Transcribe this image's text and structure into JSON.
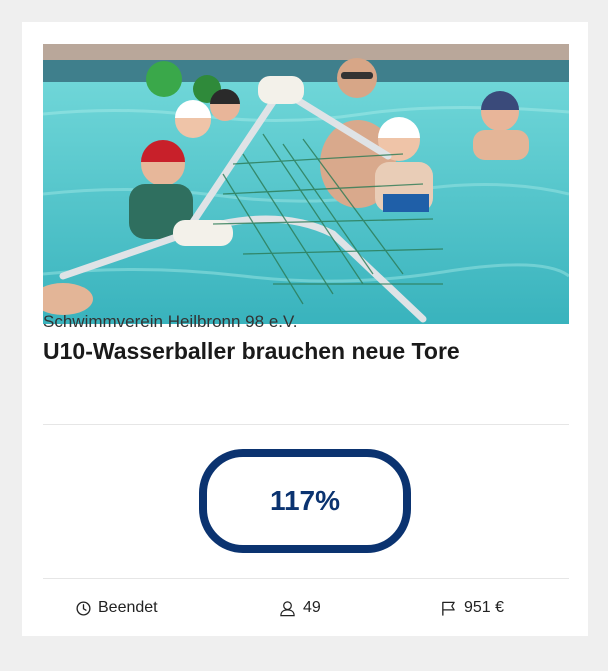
{
  "project": {
    "organization": "Schwimmverein Heilbronn 98 e.V.",
    "title": "U10-Wasserballer brauchen neue Tore",
    "progress_label": "117%",
    "progress_fraction": 1.17,
    "image_alt": "Kinder mit Badekappen im Schwimmbecken hinter einem Wasserballtor"
  },
  "stats": {
    "status": "Beendet",
    "supporters": "49",
    "amount": "951 €"
  },
  "icons": {
    "status": "clock-icon",
    "supporters": "user-icon",
    "amount": "flag-icon"
  },
  "colors": {
    "accent": "#0b3370",
    "page_background": "#efefef",
    "card_background": "#ffffff"
  }
}
